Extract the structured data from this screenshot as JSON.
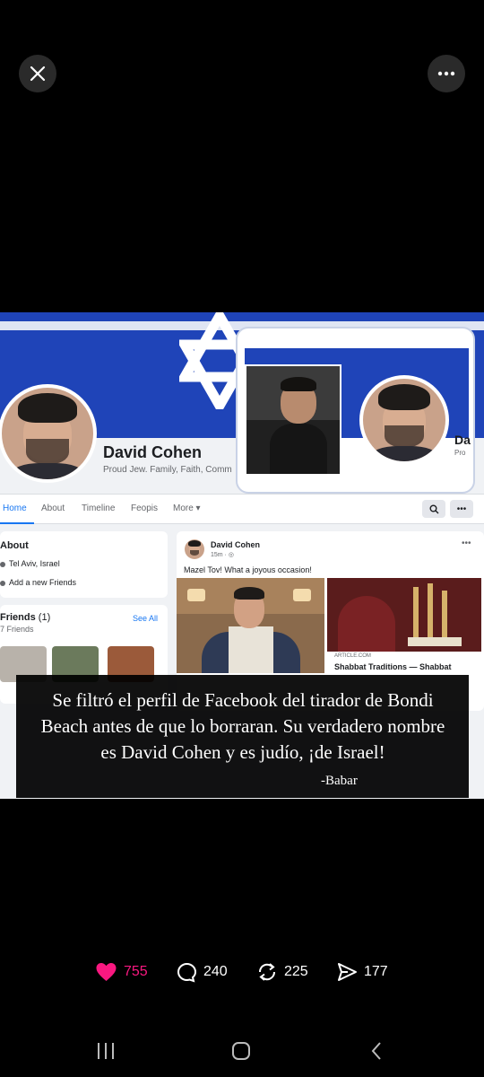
{
  "viewer": {
    "close_icon": "close-icon",
    "more_icon": "more-icon"
  },
  "screenshot": {
    "profile": {
      "name": "David Cohen",
      "bio": "Proud Jew. Family, Faith, Comm"
    },
    "tabs": [
      "Home",
      "About",
      "Timeline",
      "Feopis",
      "More ▾"
    ],
    "about": {
      "title": "About",
      "location": "Tel Aviv, Israel",
      "add_friends": "Add a new Friends"
    },
    "friends": {
      "title": "Friends",
      "count_badge": "(1)",
      "count_line": "7 Friends",
      "see_all": "See All"
    },
    "post": {
      "author": "David Cohen",
      "time": "15m · ◎",
      "text": "Mazel Tov! What a joyous occasion!",
      "article_source": "ARTICLE.COM",
      "article_title": "Shabbat Traditions — Shabbat"
    },
    "inset": {
      "name_partial": "Da",
      "sub_partial": "Pro"
    }
  },
  "caption": {
    "text": "Se filtró el perfil de Facebook del tirador de Bondi Beach antes de que lo borraran. Su verdadero nombre es David Cohen y es judío, ¡de Israel!",
    "signature": "-Babar"
  },
  "actions": {
    "likes": "755",
    "replies": "240",
    "reposts": "225",
    "shares": "177"
  },
  "colors": {
    "like": "#f91880",
    "facebook_blue": "#1877f2",
    "flag_blue": "#1f44b8"
  }
}
